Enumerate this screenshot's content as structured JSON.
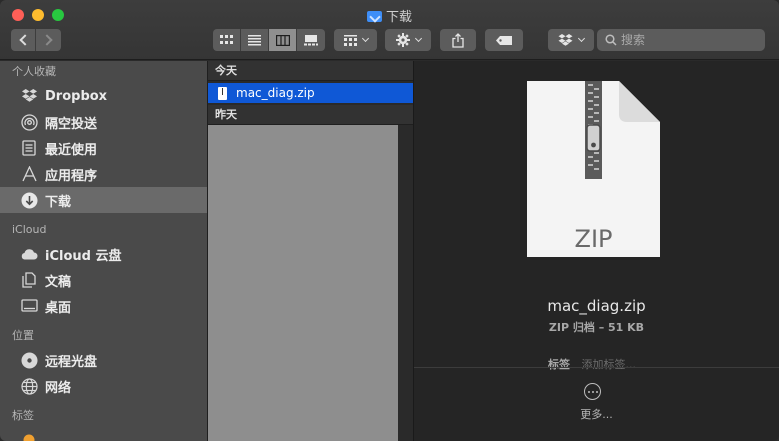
{
  "window": {
    "title": "下载"
  },
  "toolbar": {
    "view_modes": [
      "icon-view",
      "list-view",
      "column-view",
      "gallery-view"
    ],
    "active_view": "column-view",
    "search_placeholder": "搜索"
  },
  "sidebar": {
    "sections": [
      {
        "label": "个人收藏",
        "items": [
          {
            "label": "Dropbox",
            "icon": "dropbox-icon"
          },
          {
            "label": "隔空投送",
            "icon": "airdrop-icon"
          },
          {
            "label": "最近使用",
            "icon": "recents-icon"
          },
          {
            "label": "应用程序",
            "icon": "applications-icon"
          },
          {
            "label": "下载",
            "icon": "downloads-icon",
            "selected": true
          }
        ]
      },
      {
        "label": "iCloud",
        "items": [
          {
            "label": "iCloud 云盘",
            "icon": "icloud-icon"
          },
          {
            "label": "文稿",
            "icon": "documents-icon"
          },
          {
            "label": "桌面",
            "icon": "desktop-icon"
          }
        ]
      },
      {
        "label": "位置",
        "items": [
          {
            "label": "远程光盘",
            "icon": "remote-disc-icon"
          },
          {
            "label": "网络",
            "icon": "network-icon"
          }
        ]
      },
      {
        "label": "标签",
        "items": []
      }
    ]
  },
  "column": {
    "groups": [
      {
        "label": "今天",
        "files": [
          "mac_diag.zip"
        ]
      },
      {
        "label": "昨天",
        "files": []
      }
    ]
  },
  "preview": {
    "file_name": "mac_diag.zip",
    "type_label": "ZIP",
    "meta": "ZIP 归档 – 51 KB",
    "tags_label": "标签",
    "tags_placeholder": "添加标签...",
    "more_label": "更多..."
  },
  "colors": {
    "selection": "#0f58d6",
    "close": "#ff5f57",
    "minimize": "#febc2e",
    "maximize": "#28c840"
  }
}
